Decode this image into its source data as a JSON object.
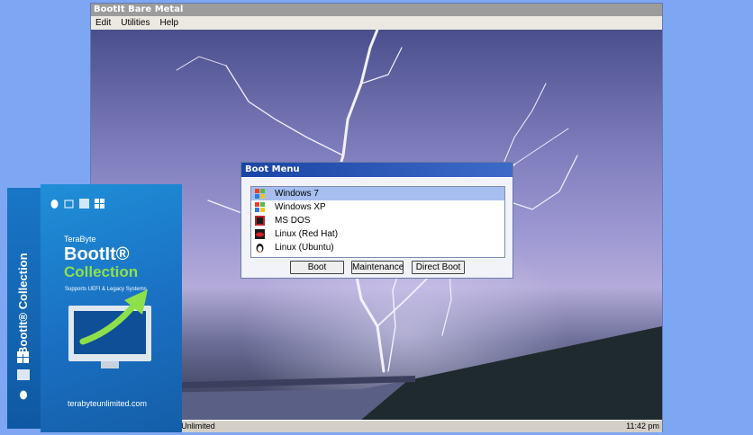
{
  "window": {
    "title": "BootIt Bare Metal",
    "menu": [
      "Edit",
      "Utilities",
      "Help"
    ],
    "status_left": "Registered To: TeraByte Unlimited",
    "status_right": "11:42 pm"
  },
  "boot_menu": {
    "title": "Boot Menu",
    "entries": [
      {
        "label": "Windows 7",
        "icon": "windows-flag-icon",
        "selected": true
      },
      {
        "label": "Windows XP",
        "icon": "windows-flag-icon",
        "selected": false
      },
      {
        "label": "MS DOS",
        "icon": "ms-dos-icon",
        "selected": false
      },
      {
        "label": "Linux (Red Hat)",
        "icon": "red-hat-icon",
        "selected": false
      },
      {
        "label": "Linux (Ubuntu)",
        "icon": "tux-icon",
        "selected": false
      }
    ],
    "buttons": {
      "boot": "Boot",
      "maintenance": "Maintenance",
      "direct_boot": "Direct Boot"
    }
  },
  "product_box": {
    "spine": "BootIt® Collection",
    "brand": "TeraByte",
    "name": "BootIt®",
    "edition": "Collection",
    "tagline": "Supports UEFI & Legacy Systems",
    "url": "terabyteunlimited.com"
  },
  "colors": {
    "page_background": "#7ea6f3",
    "dialog_title": "#1a45a3",
    "selection": "#a6bff0",
    "box_blue": "#1a6fc2",
    "box_green": "#8ee04b"
  }
}
